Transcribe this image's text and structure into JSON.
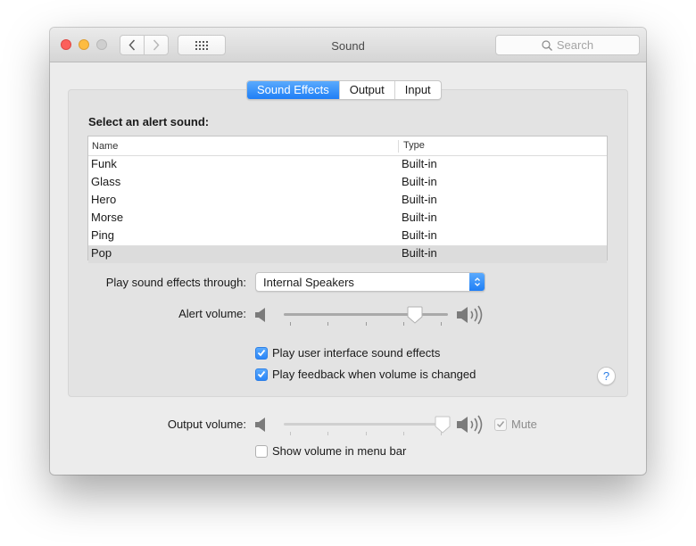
{
  "window": {
    "title": "Sound",
    "search_placeholder": "Search"
  },
  "tabs": [
    {
      "label": "Sound Effects",
      "active": true
    },
    {
      "label": "Output",
      "active": false
    },
    {
      "label": "Input",
      "active": false
    }
  ],
  "sound_effects": {
    "section_label": "Select an alert sound:",
    "columns": [
      "Name",
      "Type"
    ],
    "rows": [
      {
        "name": "Funk",
        "type": "Built-in",
        "selected": false
      },
      {
        "name": "Glass",
        "type": "Built-in",
        "selected": false
      },
      {
        "name": "Hero",
        "type": "Built-in",
        "selected": false
      },
      {
        "name": "Morse",
        "type": "Built-in",
        "selected": false
      },
      {
        "name": "Ping",
        "type": "Built-in",
        "selected": false
      },
      {
        "name": "Pop",
        "type": "Built-in",
        "selected": true
      }
    ],
    "play_through_label": "Play sound effects through:",
    "play_through_value": "Internal Speakers",
    "alert_volume_label": "Alert volume:",
    "alert_volume_fraction": 0.82,
    "checkboxes": [
      {
        "label": "Play user interface sound effects",
        "checked": true
      },
      {
        "label": "Play feedback when volume is changed",
        "checked": true
      }
    ],
    "help_label": "?"
  },
  "output": {
    "output_volume_label": "Output volume:",
    "output_volume_fraction": 1.0,
    "mute_label": "Mute",
    "mute_checked": true,
    "show_volume_label": "Show volume in menu bar",
    "show_volume_checked": false
  },
  "colors": {
    "accent": "#1f7ff6",
    "close": "#fc605b",
    "minimize": "#fdbc40",
    "zoom": "#cfcfcf"
  }
}
